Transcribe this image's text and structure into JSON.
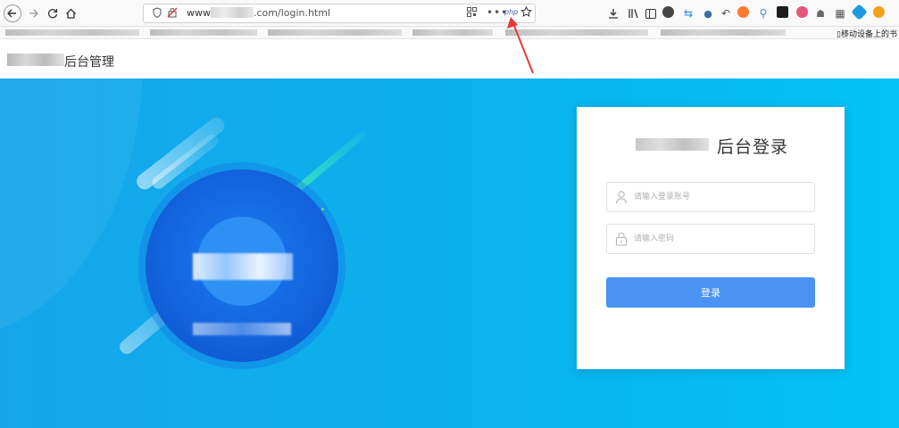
{
  "browser": {
    "url_prefix": "www",
    "url_suffix": ".com/login.html",
    "extension_php_label": "php",
    "bookmarks_mobile_label": "移动设备上的书"
  },
  "header": {
    "site_title": "后台管理"
  },
  "login": {
    "card_title": "后台登录",
    "username_placeholder": "请输入登录账号",
    "password_placeholder": "请输入密码",
    "submit_label": "登录"
  },
  "colors": {
    "hero_start": "#16a5ea",
    "hero_end": "#02c2f6",
    "button": "#4a93f2",
    "annotation_arrow": "#e53935"
  }
}
